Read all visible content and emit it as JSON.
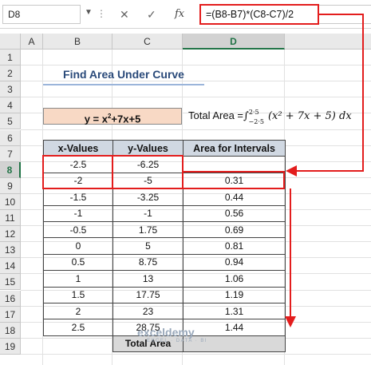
{
  "formula_bar": {
    "cell_ref": "D8",
    "formula": "=(B8-B7)*(C8-C7)/2",
    "cancel_glyph": "✕",
    "enter_glyph": "✓",
    "fx_glyph": "fx"
  },
  "columns": [
    "A",
    "B",
    "C",
    "D"
  ],
  "rows": [
    "1",
    "2",
    "3",
    "4",
    "5",
    "6",
    "7",
    "8",
    "9",
    "10",
    "11",
    "12",
    "13",
    "14",
    "15",
    "16",
    "17",
    "18",
    "19"
  ],
  "title": "Find Area Under Curve",
  "equation": {
    "prefix": "y = x",
    "power": "2",
    "suffix": "+7x+5"
  },
  "total_area_formula": {
    "label": "Total Area =",
    "upper": "2·5",
    "lower": "−2·5",
    "integrand": "(x² + 7x + 5) dx"
  },
  "table": {
    "headers": [
      "x-Values",
      "y-Values",
      "Area for Intervals"
    ],
    "rows": [
      [
        "-2.5",
        "-6.25",
        ""
      ],
      [
        "-2",
        "-5",
        "0.31"
      ],
      [
        "-1.5",
        "-3.25",
        "0.44"
      ],
      [
        "-1",
        "-1",
        "0.56"
      ],
      [
        "-0.5",
        "1.75",
        "0.69"
      ],
      [
        "0",
        "5",
        "0.81"
      ],
      [
        "0.5",
        "8.75",
        "0.94"
      ],
      [
        "1",
        "13",
        "1.06"
      ],
      [
        "1.5",
        "17.75",
        "1.19"
      ],
      [
        "2",
        "23",
        "1.31"
      ],
      [
        "2.5",
        "28.75",
        "1.44"
      ]
    ],
    "total_label": "Total Area"
  },
  "watermark": {
    "name": "exceldemy",
    "tagline": "EXCEL · DATA · BI"
  },
  "colors": {
    "annotation_red": "#e31d1d",
    "header_fill": "#d0d8e2",
    "equation_fill": "#f8d9c5",
    "excel_green": "#217346"
  }
}
